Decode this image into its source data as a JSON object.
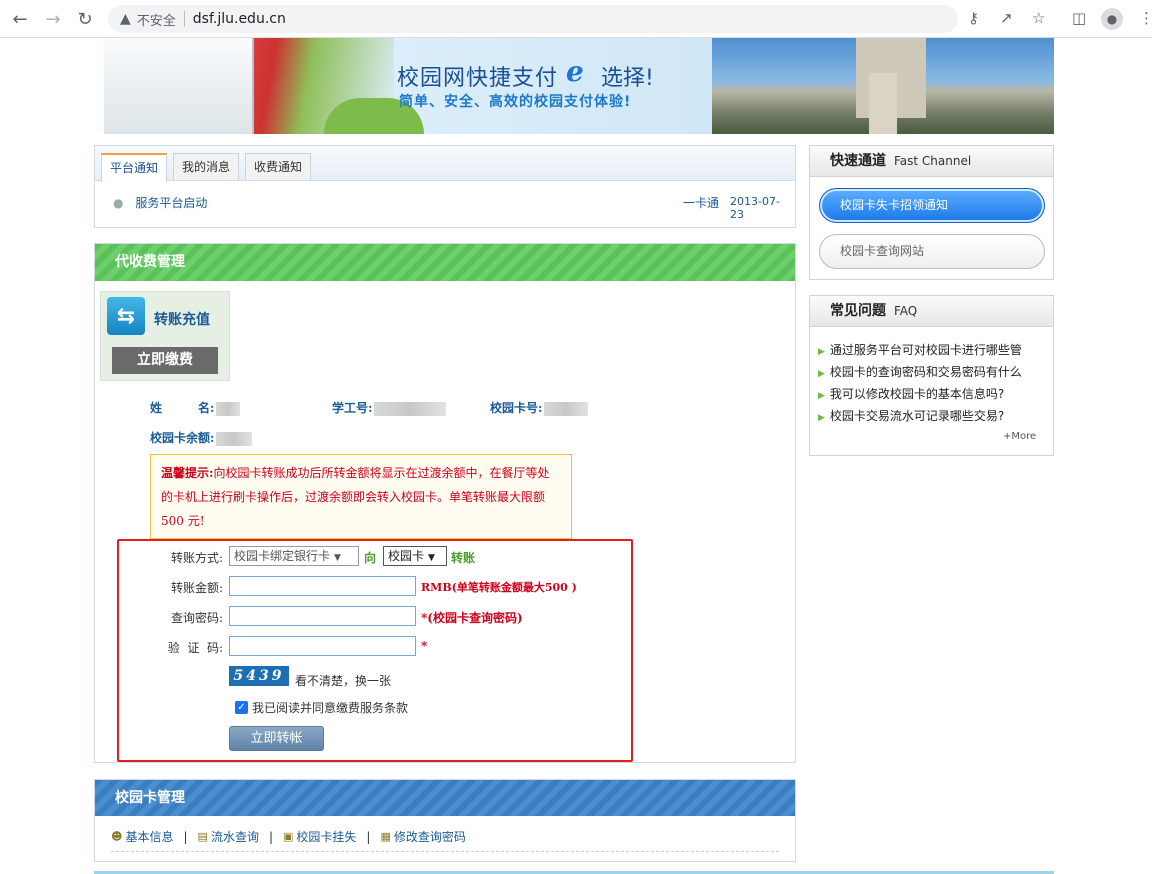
{
  "browser": {
    "security_label": "不安全",
    "url": "dsf.jlu.edu.cn"
  },
  "banner": {
    "title_part1": "校园网快捷支付",
    "title_part2": "选择!",
    "subtitle": "简单、安全、高效的校园支付体验!"
  },
  "notice": {
    "tabs": [
      "平台通知",
      "我的消息",
      "收费通知"
    ],
    "items": [
      {
        "title": "服务平台启动",
        "category": "一卡通",
        "date": "2013-07-23"
      }
    ]
  },
  "payment": {
    "header": "代收费管理",
    "card_title": "转账充值",
    "card_button": "立即缴费",
    "info": {
      "name_label": "姓　　　名:",
      "student_id_label": "学工号:",
      "card_no_label": "校园卡号:",
      "balance_label": "校园卡余额:"
    },
    "tip_label": "温馨提示:",
    "tip_text": "向校园卡转账成功后所转金额将显示在过渡余额中，在餐厅等处的卡机上进行刷卡操作后，过渡余额即会转入校园卡。单笔转账最大限额500 元!",
    "form": {
      "method_label": "转账方式:",
      "method_from": "校园卡绑定银行卡",
      "method_to_word": "向",
      "method_to": "校园卡",
      "method_suffix": "转账",
      "amount_label": "转账金额:",
      "amount_note": "RMB(单笔转账金额最大500 )",
      "password_label": "查询密码:",
      "password_note": "*(校园卡查询密码)",
      "captcha_label": "验  证  码:",
      "captcha_note": "*",
      "captcha_code": "5439",
      "captcha_refresh": "看不清楚，换一张",
      "agree_text": "我已阅读并同意缴费服务条款",
      "submit": "立即转帐"
    }
  },
  "card_management": {
    "header": "校园卡管理",
    "links": [
      "基本信息",
      "流水查询",
      "校园卡挂失",
      "修改查询密码"
    ]
  },
  "fast_channel": {
    "title": "快速通道",
    "subtitle": "Fast Channel",
    "buttons": [
      "校园卡失卡招领通知",
      "校园卡查询网站"
    ]
  },
  "faq": {
    "title": "常见问题",
    "subtitle": "FAQ",
    "items": [
      "通过服务平台可对校园卡进行哪些管",
      "校园卡的查询密码和交易密码有什么",
      "我可以修改校园卡的基本信息吗?",
      "校园卡交易流水可记录哪些交易?"
    ],
    "more": "More"
  }
}
